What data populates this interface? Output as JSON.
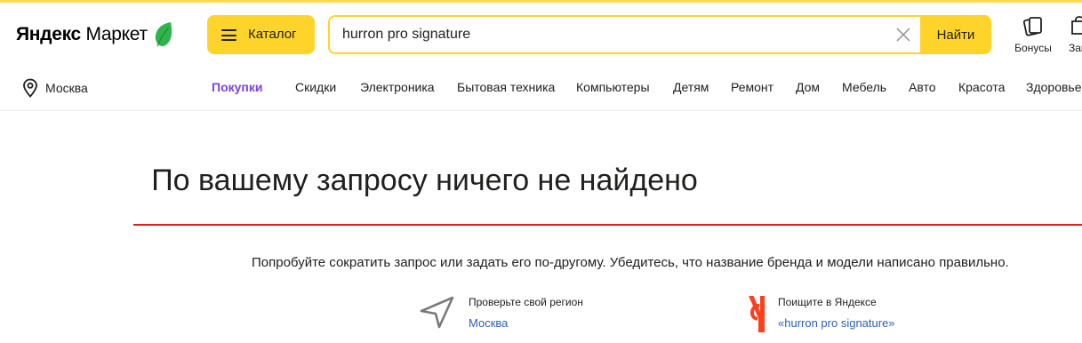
{
  "header": {
    "logo": {
      "text_bold": "Яндекс",
      "text_regular": "Маркет"
    },
    "catalog_label": "Каталог",
    "search": {
      "value": "hurron pro signature",
      "placeholder": "Искать товары",
      "button_label": "Найти"
    },
    "bonus_label": "Бонусы",
    "favorites_label": "Заказы"
  },
  "nav": {
    "region": "Москва",
    "items": [
      {
        "label": "Покупки",
        "active": true
      },
      {
        "label": "Скидки"
      },
      {
        "label": "Электроника"
      },
      {
        "label": "Бытовая техника"
      },
      {
        "label": "Компьютеры"
      },
      {
        "label": "Детям"
      },
      {
        "label": "Ремонт"
      },
      {
        "label": "Дом"
      },
      {
        "label": "Мебель"
      },
      {
        "label": "Авто"
      },
      {
        "label": "Красота"
      },
      {
        "label": "Здоровье"
      }
    ]
  },
  "main": {
    "title": "По вашему запросу ничего не найдено",
    "hint": "Попробуйте сократить запрос или задать его по-другому. Убедитесь, что название бренда и модели написано правильно.",
    "tips": [
      {
        "title": "Проверьте свой регион",
        "link": "Москва",
        "icon": "navigation-arrow-icon"
      },
      {
        "title": "Поищите в Яндексе",
        "link": "«hurron pro signature»",
        "icon": "yandex-logo-icon"
      }
    ]
  },
  "colors": {
    "accent_yellow": "#fed42b",
    "active_nav": "#7b45d9",
    "link_blue": "#2e5fb5",
    "divider_red": "#e01f1f",
    "leaf_green": "#2fb34a",
    "yandex_red": "#fc3f1d"
  }
}
